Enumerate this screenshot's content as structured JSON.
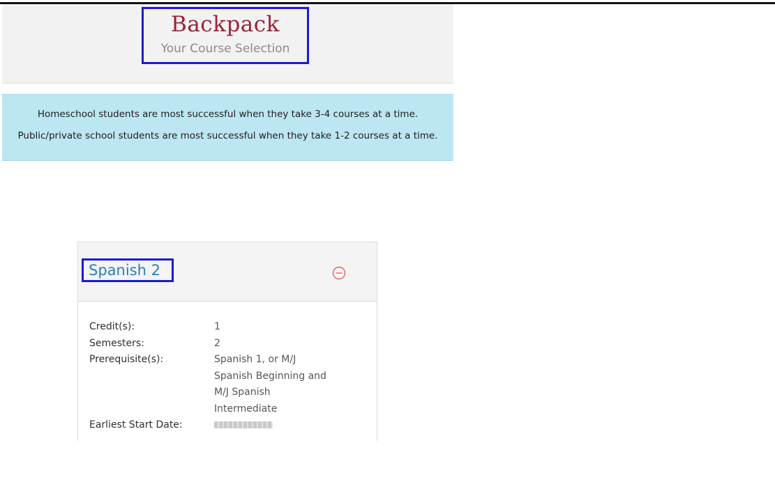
{
  "header": {
    "title": "Backpack",
    "subtitle": "Your Course Selection"
  },
  "notice": {
    "line1": "Homeschool students are most successful when they take 3-4 courses at a time.",
    "line2": "Public/private school students are most successful when they take 1-2 courses at a time."
  },
  "course": {
    "title": "Spanish 2",
    "remove_icon": "minus-circle-icon",
    "details": [
      {
        "label": "Credit(s):",
        "value": "1"
      },
      {
        "label": "Semesters:",
        "value": "2"
      },
      {
        "label": "Prerequisite(s):",
        "value": "Spanish 1, or M/J Spanish Beginning and M/J Spanish Intermediate"
      },
      {
        "label": "Earliest Start Date:",
        "value": ""
      }
    ]
  },
  "colors": {
    "title": "#9b2336",
    "subtitle": "#8a8a8a",
    "alert_background": "#bde6f3",
    "course_link": "#2a7fb8",
    "remove_icon": "#e5606a",
    "highlight_box": "#1a1ad6"
  }
}
